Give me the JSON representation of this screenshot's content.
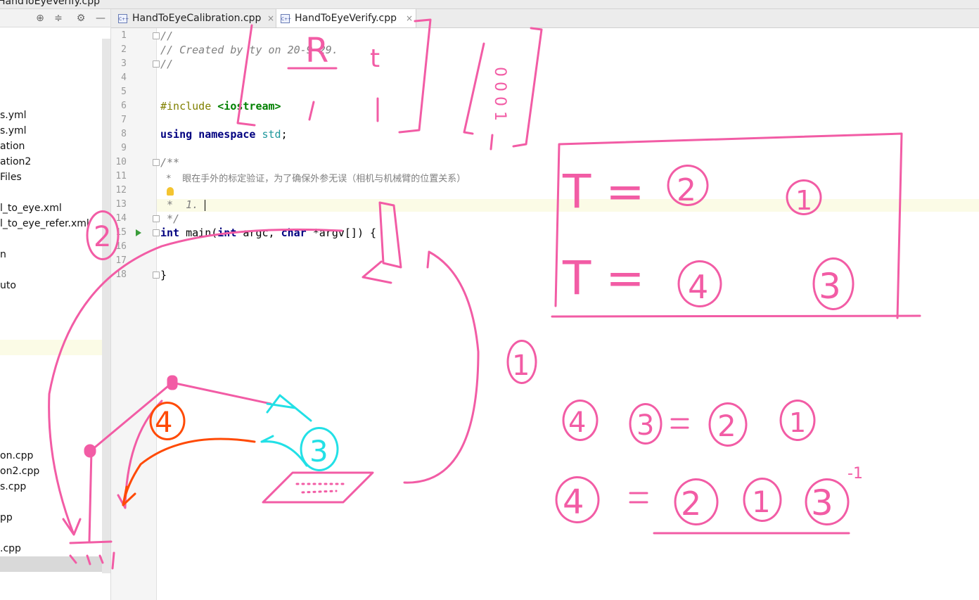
{
  "window": {
    "title": "HandToEyeVerify.cpp"
  },
  "project_tree": {
    "items": [
      {
        "label": "s.yml",
        "top": 0
      },
      {
        "label": "s.yml"
      },
      {
        "label": "ation"
      },
      {
        "label": "ation2"
      },
      {
        "label": "Files"
      },
      {
        "label": "l_to_eye.xml"
      },
      {
        "label": "l_to_eye_refer.xml"
      },
      {
        "label": "n"
      },
      {
        "label": "uto"
      },
      {
        "label": "on.cpp"
      },
      {
        "label": "on2.cpp"
      },
      {
        "label": "s.cpp"
      },
      {
        "label": "pp"
      },
      {
        "label": ".cpp"
      }
    ]
  },
  "tabs": [
    {
      "label": "HandToEyeCalibration.cpp",
      "active": false
    },
    {
      "label": "HandToEyeVerify.cpp",
      "active": true
    }
  ],
  "editor": {
    "line_numbers": [
      "1",
      "2",
      "3",
      "4",
      "5",
      "6",
      "7",
      "8",
      "9",
      "10",
      "11",
      "12",
      "13",
      "14",
      "15",
      "16",
      "17",
      "18"
    ],
    "l1": "//",
    "l2": "// Created by ty on 20-9-29.",
    "l3": "//",
    "l6_pp": "#include ",
    "l6_inc": "<iostream>",
    "l8_kw1": "using",
    "l8_kw2": "namespace",
    "l8_ns": "std",
    "l8_end": ";",
    "l10": "/**",
    "l11": " *  眼在手外的标定验证，为了确保外参无误（相机与机械臂的位置关系）",
    "l13": " *  1.",
    "l14": " */",
    "l15_kw": "int",
    "l15_rest1": " main(",
    "l15_kw2": "int",
    "l15_rest2": " argc, ",
    "l15_kw3": "char",
    "l15_rest3": " *argv[]) {",
    "l18": "}"
  },
  "annotations": {
    "matrix_R": "R",
    "matrix_t": "t",
    "matrix_col": "0 0 0 1",
    "eq1_lhs": "T =",
    "eq1_a": "2",
    "eq1_b": "1",
    "eq2_lhs": "T =",
    "eq2_a": "4",
    "eq2_b": "3",
    "label_1": "1",
    "label_2": "2",
    "label_3": "3",
    "label_4": "4",
    "eq3_a": "4",
    "eq3_b": "3",
    "eq3_c": "2",
    "eq3_d": "1",
    "eq4_a": "4",
    "eq4_b": "2",
    "eq4_c": "1",
    "eq4_d": "3",
    "eq4_exp": "-1",
    "colors": {
      "pink": "#f25ca5",
      "cyan": "#22e0e6",
      "orange": "#ff4a05"
    }
  }
}
